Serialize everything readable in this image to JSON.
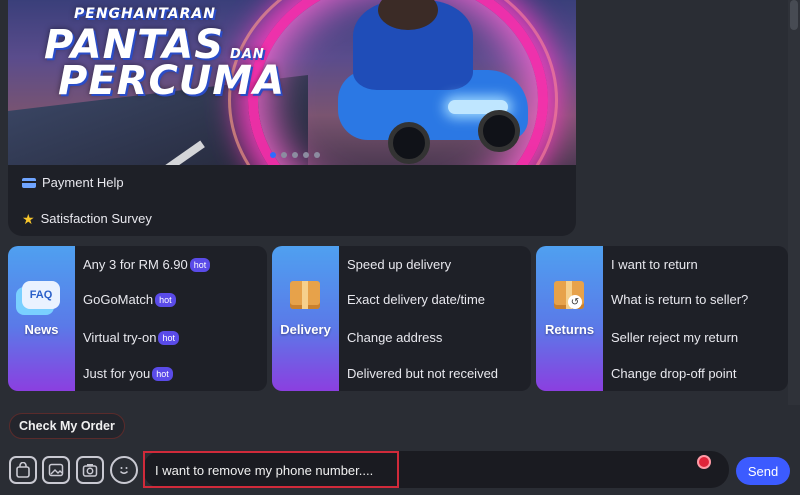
{
  "banner": {
    "line1": "PENGHANTARAN",
    "line2": "PANTAS",
    "line2_small": "DAN",
    "line3": "PERCUMA",
    "dots": 5,
    "active_dot": 0
  },
  "help_links": [
    {
      "label": "Payment Help",
      "icon": "credit-card-icon"
    },
    {
      "label": "Satisfaction Survey",
      "icon": "star-icon"
    }
  ],
  "panels": [
    {
      "tile_label": "News",
      "tile_icon": "faq-bubble-icon",
      "tile_icon_text": "FAQ",
      "links": [
        {
          "label": "Any 3 for RM 6.90",
          "badge": "hot"
        },
        {
          "label": "GoGoMatch",
          "badge": "hot"
        },
        {
          "label": "Virtual try-on",
          "badge": "hot"
        },
        {
          "label": "Just for you",
          "badge": "hot"
        }
      ]
    },
    {
      "tile_label": "Delivery",
      "tile_icon": "parcel-box-icon",
      "links": [
        {
          "label": "Speed up delivery"
        },
        {
          "label": "Exact delivery date/time"
        },
        {
          "label": "Change address"
        },
        {
          "label": "Delivered but not received"
        }
      ]
    },
    {
      "tile_label": "Returns",
      "tile_icon": "return-box-icon",
      "links": [
        {
          "label": "I want to return"
        },
        {
          "label": "What is return to seller?"
        },
        {
          "label": "Seller reject my return"
        },
        {
          "label": "Change drop-off point"
        }
      ]
    }
  ],
  "bottom": {
    "check_order_label": "Check My Order",
    "tools": [
      "shopping-bag-icon",
      "image-icon",
      "camera-icon",
      "emoji-icon"
    ],
    "message_value": "I want to remove my phone number....",
    "send_label": "Send"
  },
  "colors": {
    "accent": "#3c5bff",
    "hot_badge": "#5a4be8",
    "highlight_border": "#d02a3a"
  }
}
